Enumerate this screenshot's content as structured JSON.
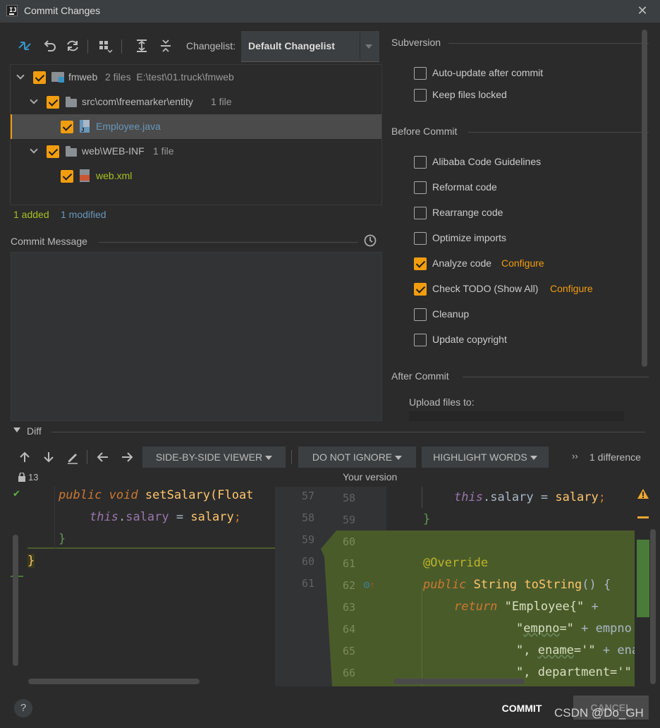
{
  "window": {
    "title": "Commit Changes",
    "close_icon": "close-icon",
    "app_icon": "intellij-icon"
  },
  "toolbar": {
    "changelist_label": "Changelist:",
    "changelist_value": "Default Changelist"
  },
  "tree": {
    "root": {
      "name": "fmweb",
      "info": "2 files  E:\\test\\01.truck\\fmweb",
      "checked": true
    },
    "items": [
      {
        "name": "src\\com\\freemarker\\entity",
        "info": "1 file",
        "checked": true
      },
      {
        "name": "Employee.java",
        "checked": true
      },
      {
        "name": "web\\WEB-INF",
        "info": "1 file",
        "checked": true
      },
      {
        "name": "web.xml",
        "checked": true
      }
    ]
  },
  "status": {
    "added": "1 added",
    "modified": "1 modified"
  },
  "commit_message": {
    "label": "Commit Message",
    "value": ""
  },
  "subversion": {
    "header": "Subversion",
    "options": [
      {
        "label": "Auto-update after commit",
        "checked": false
      },
      {
        "label": "Keep files locked",
        "checked": false
      }
    ]
  },
  "before_commit": {
    "header": "Before Commit",
    "options": [
      {
        "label": "Alibaba Code Guidelines",
        "checked": false
      },
      {
        "label": "Reformat code",
        "checked": false
      },
      {
        "label": "Rearrange code",
        "checked": false
      },
      {
        "label": "Optimize imports",
        "checked": false
      },
      {
        "label": "Analyze code",
        "checked": true,
        "link": "Configure"
      },
      {
        "label": "Check TODO (Show All)",
        "checked": true,
        "link": "Configure"
      },
      {
        "label": "Cleanup",
        "checked": false
      },
      {
        "label": "Update copyright",
        "checked": false
      }
    ]
  },
  "after_commit": {
    "header": "After Commit",
    "upload_label": "Upload files to:"
  },
  "diff": {
    "header": "Diff",
    "viewer": "SIDE-BY-SIDE VIEWER",
    "ignore": "DO NOT IGNORE",
    "highlight": "HIGHLIGHT WORDS",
    "difference_count": "1 difference",
    "lock_count": "13",
    "your_version": "Your version",
    "left_line_numbers": [
      "57",
      "58",
      "59",
      "60",
      "61"
    ],
    "right_line_numbers": [
      "58",
      "59",
      "60",
      "61",
      "62",
      "63",
      "64",
      "65",
      "66"
    ]
  },
  "footer": {
    "commit": "COMMIT",
    "cancel": "CANCEL",
    "help": "?",
    "watermark": "CSDN @Do_GH"
  },
  "colors": {
    "accent_orange": "#f29d0e",
    "added_green": "#a8c023",
    "modified_blue": "#6897bb",
    "diff_green": "#4a5b2a"
  }
}
